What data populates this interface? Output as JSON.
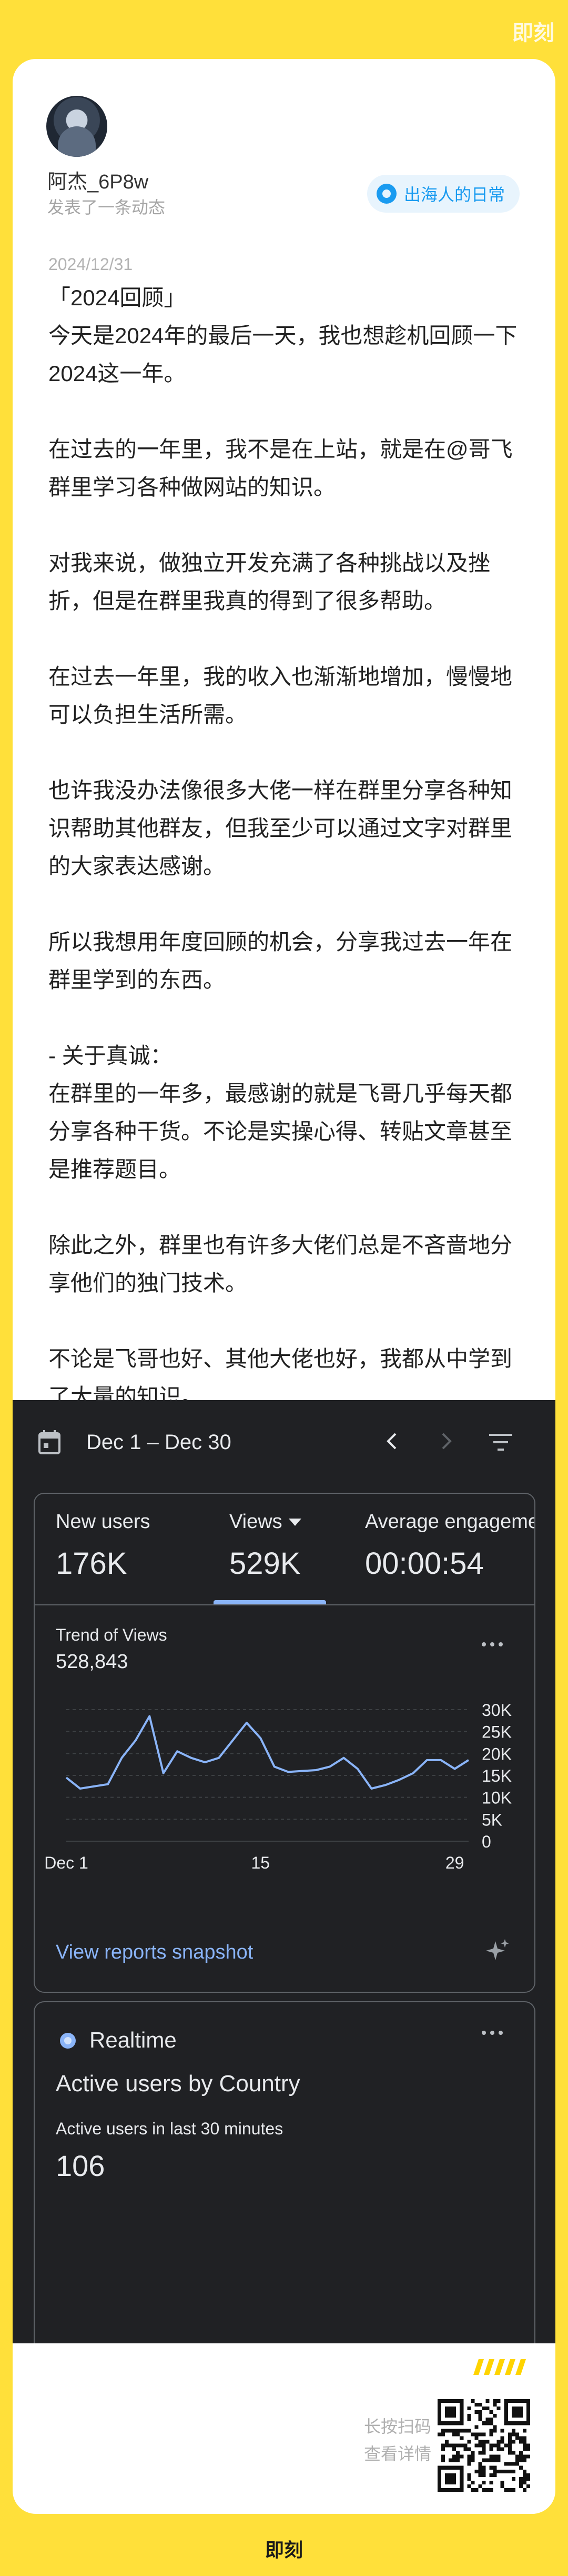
{
  "app": {
    "brand": "即刻"
  },
  "post": {
    "author": "阿杰_6P8w",
    "action": "发表了一条动态",
    "topic_tag": "出海人的日常",
    "date": "2024/12/31",
    "paragraphs": [
      "「2024回顾」\n今天是2024年的最后一天，我也想趁机回顾一下2024这一年。",
      "在过去的一年里，我不是在上站，就是在@哥飞 群里学习各种做网站的知识。",
      "对我来说，做独立开发充满了各种挑战以及挫折，但是在群里我真的得到了很多帮助。",
      "在过去一年里，我的收入也渐渐地增加，慢慢地可以负担生活所需。",
      "也许我没办法像很多大佬一样在群里分享各种知识帮助其他群友，但我至少可以通过文字对群里的大家表达感谢。",
      "所以我想用年度回顾的机会，分享我过去一年在群里学到的东西。",
      "- 关于真诚：\n在群里的一年多，最感谢的就是飞哥几乎每天都分享各种干货。不论是实操心得、转贴文章甚至是推荐题目。",
      "除此之外，群里也有许多大佬们总是不吝啬地分享他们的独门技术。",
      "不论是飞哥也好、其他大佬也好，我都从中学到了大量的知识。..."
    ]
  },
  "analytics": {
    "date_range": "Dec 1 – Dec 30",
    "metrics": [
      {
        "label": "New users",
        "value": "176K"
      },
      {
        "label": "Views",
        "value": "529K"
      },
      {
        "label": "Average engagement",
        "value": "00:00:54"
      }
    ],
    "trend_label": "Trend of Views",
    "trend_total": "528,843",
    "view_reports_label": "View reports snapshot",
    "realtime": {
      "title": "Realtime",
      "subtitle": "Active users by Country",
      "period_label": "Active users in last 30 minutes",
      "count": "106"
    },
    "colors": {
      "background": "#202124",
      "line": "#8ab4f8",
      "border": "#5f6368"
    }
  },
  "chart_data": {
    "type": "line",
    "title": "Trend of Views",
    "x": [
      1,
      2,
      3,
      4,
      5,
      6,
      7,
      8,
      9,
      10,
      11,
      12,
      13,
      14,
      15,
      16,
      17,
      18,
      19,
      20,
      21,
      22,
      23,
      24,
      25,
      26,
      27,
      28,
      29,
      30
    ],
    "x_tick_labels": [
      "Dec 1",
      "15",
      "29"
    ],
    "series": [
      {
        "values": [
          14500,
          12000,
          12500,
          13000,
          19000,
          23000,
          28500,
          15500,
          20500,
          19000,
          18000,
          19000,
          23000,
          27000,
          23500,
          17000,
          15800,
          16000,
          16200,
          17000,
          19000,
          16500,
          12000,
          12800,
          14000,
          15500,
          18500,
          18500,
          16500,
          18500
        ]
      }
    ],
    "y_ticks": [
      0,
      5000,
      10000,
      15000,
      20000,
      25000,
      30000
    ],
    "y_tick_labels": [
      "0",
      "5K",
      "10K",
      "15K",
      "20K",
      "25K",
      "30K"
    ],
    "ylim": [
      0,
      30000
    ],
    "grid": true
  },
  "footer": {
    "scan_line1": "长按扫码",
    "scan_line2": "查看详情"
  },
  "icons": [
    "calendar-icon",
    "chevron-left-icon",
    "chevron-right-icon",
    "filter-icon",
    "more-icon",
    "sparkle-icon",
    "realtime-dot-icon",
    "qr-code"
  ]
}
